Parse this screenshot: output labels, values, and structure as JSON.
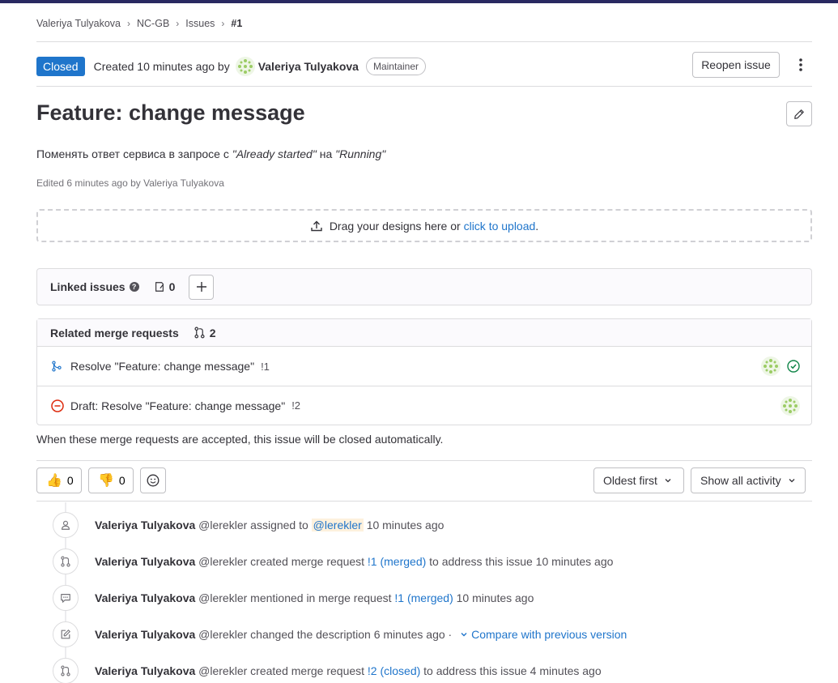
{
  "breadcrumb": [
    "Valeriya Tulyakova",
    "NC-GB",
    "Issues",
    "#1"
  ],
  "header": {
    "status": "Closed",
    "created_text": "Created 10 minutes ago by",
    "author": "Valeriya Tulyakova",
    "role": "Maintainer",
    "reopen_label": "Reopen issue"
  },
  "issue": {
    "title": "Feature: change message",
    "desc_prefix": "Поменять ответ сервиса в запросе с ",
    "desc_quote1": "\"Already started\"",
    "desc_mid": " на ",
    "desc_quote2": "\"Running\"",
    "edited": "Edited 6 minutes ago by Valeriya Tulyakova"
  },
  "upload": {
    "text": "Drag your designs here or ",
    "link": "click to upload",
    "suffix": "."
  },
  "linked_issues": {
    "label": "Linked issues",
    "count": "0"
  },
  "related_mrs": {
    "label": "Related merge requests",
    "count": "2",
    "items": [
      {
        "title": "Resolve \"Feature: change message\"",
        "ref": "!1"
      },
      {
        "title": "Draft: Resolve \"Feature: change message\"",
        "ref": "!2"
      }
    ]
  },
  "auto_close": "When these merge requests are accepted, this issue will be closed automatically.",
  "reactions": {
    "thumbs_up": "0",
    "thumbs_down": "0"
  },
  "sort": {
    "order": "Oldest first",
    "filter": "Show all activity"
  },
  "colors": {
    "status_closed": "#1f75cb",
    "link": "#1f75cb",
    "merged_check": "#108548",
    "closed_red": "#dd2b0e"
  },
  "timeline": [
    {
      "icon": "user-icon",
      "author": "Valeriya Tulyakova",
      "handle": "@lerekler",
      "action": "assigned to",
      "mention": "@lerekler",
      "time": "10 minutes ago"
    },
    {
      "icon": "merge-request-icon",
      "author": "Valeriya Tulyakova",
      "handle": "@lerekler",
      "action": "created merge request",
      "link": "!1 (merged)",
      "after": "to address this issue 10 minutes ago"
    },
    {
      "icon": "comment-icon",
      "author": "Valeriya Tulyakova",
      "handle": "@lerekler",
      "action": "mentioned in merge request",
      "link": "!1 (merged)",
      "after": "10 minutes ago"
    },
    {
      "icon": "pencil-square-icon",
      "author": "Valeriya Tulyakova",
      "handle": "@lerekler",
      "action": "changed the description 6 minutes ago ·",
      "link": "Compare with previous version"
    },
    {
      "icon": "merge-request-icon",
      "author": "Valeriya Tulyakova",
      "handle": "@lerekler",
      "action": "created merge request",
      "link": "!2 (closed)",
      "after": "to address this issue 4 minutes ago"
    }
  ]
}
